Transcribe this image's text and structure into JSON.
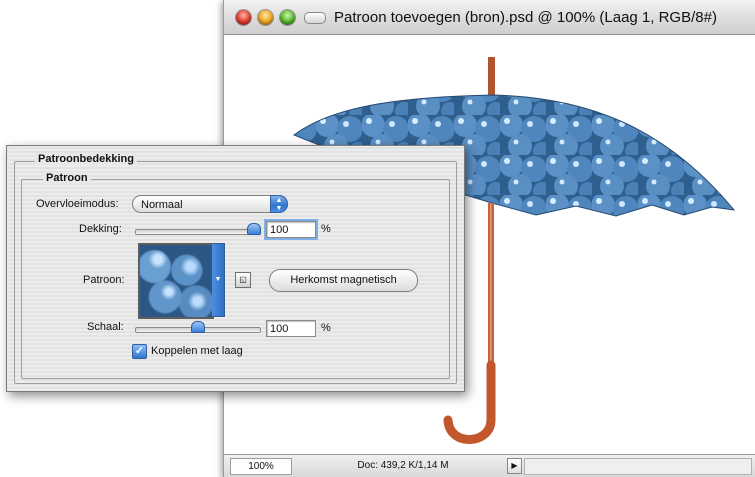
{
  "window": {
    "title": "Patroon toevoegen (bron).psd @ 100% (Laag 1, RGB/8#)",
    "zoom": "100%",
    "doc_info": "Doc: 439,2 K/1,14 M",
    "status_menu_arrow": "▶"
  },
  "dialog": {
    "group_title": "Patroonbedekking",
    "subgroup_title": "Patroon",
    "blend_mode_label": "Overvloeimodus:",
    "blend_mode_value": "Normaal",
    "opacity_label": "Dekking:",
    "opacity_value": "100",
    "opacity_unit": "%",
    "opacity_slider_fraction": 1.0,
    "pattern_label": "Patroon:",
    "pattern_picker_icon": "pattern-swatch",
    "snap_button_icon": "new-preset-icon",
    "snap_to_origin_label": "Herkomst magnetisch",
    "scale_label": "Schaal:",
    "scale_value": "100",
    "scale_unit": "%",
    "scale_slider_fraction": 0.5,
    "link_with_layer_label": "Koppelen met laag",
    "link_with_layer_checked": true
  },
  "colors": {
    "accent": "#2f74d0",
    "umbrella_blue": "#3f6f9c",
    "umbrella_shaft": "#c8643a"
  }
}
